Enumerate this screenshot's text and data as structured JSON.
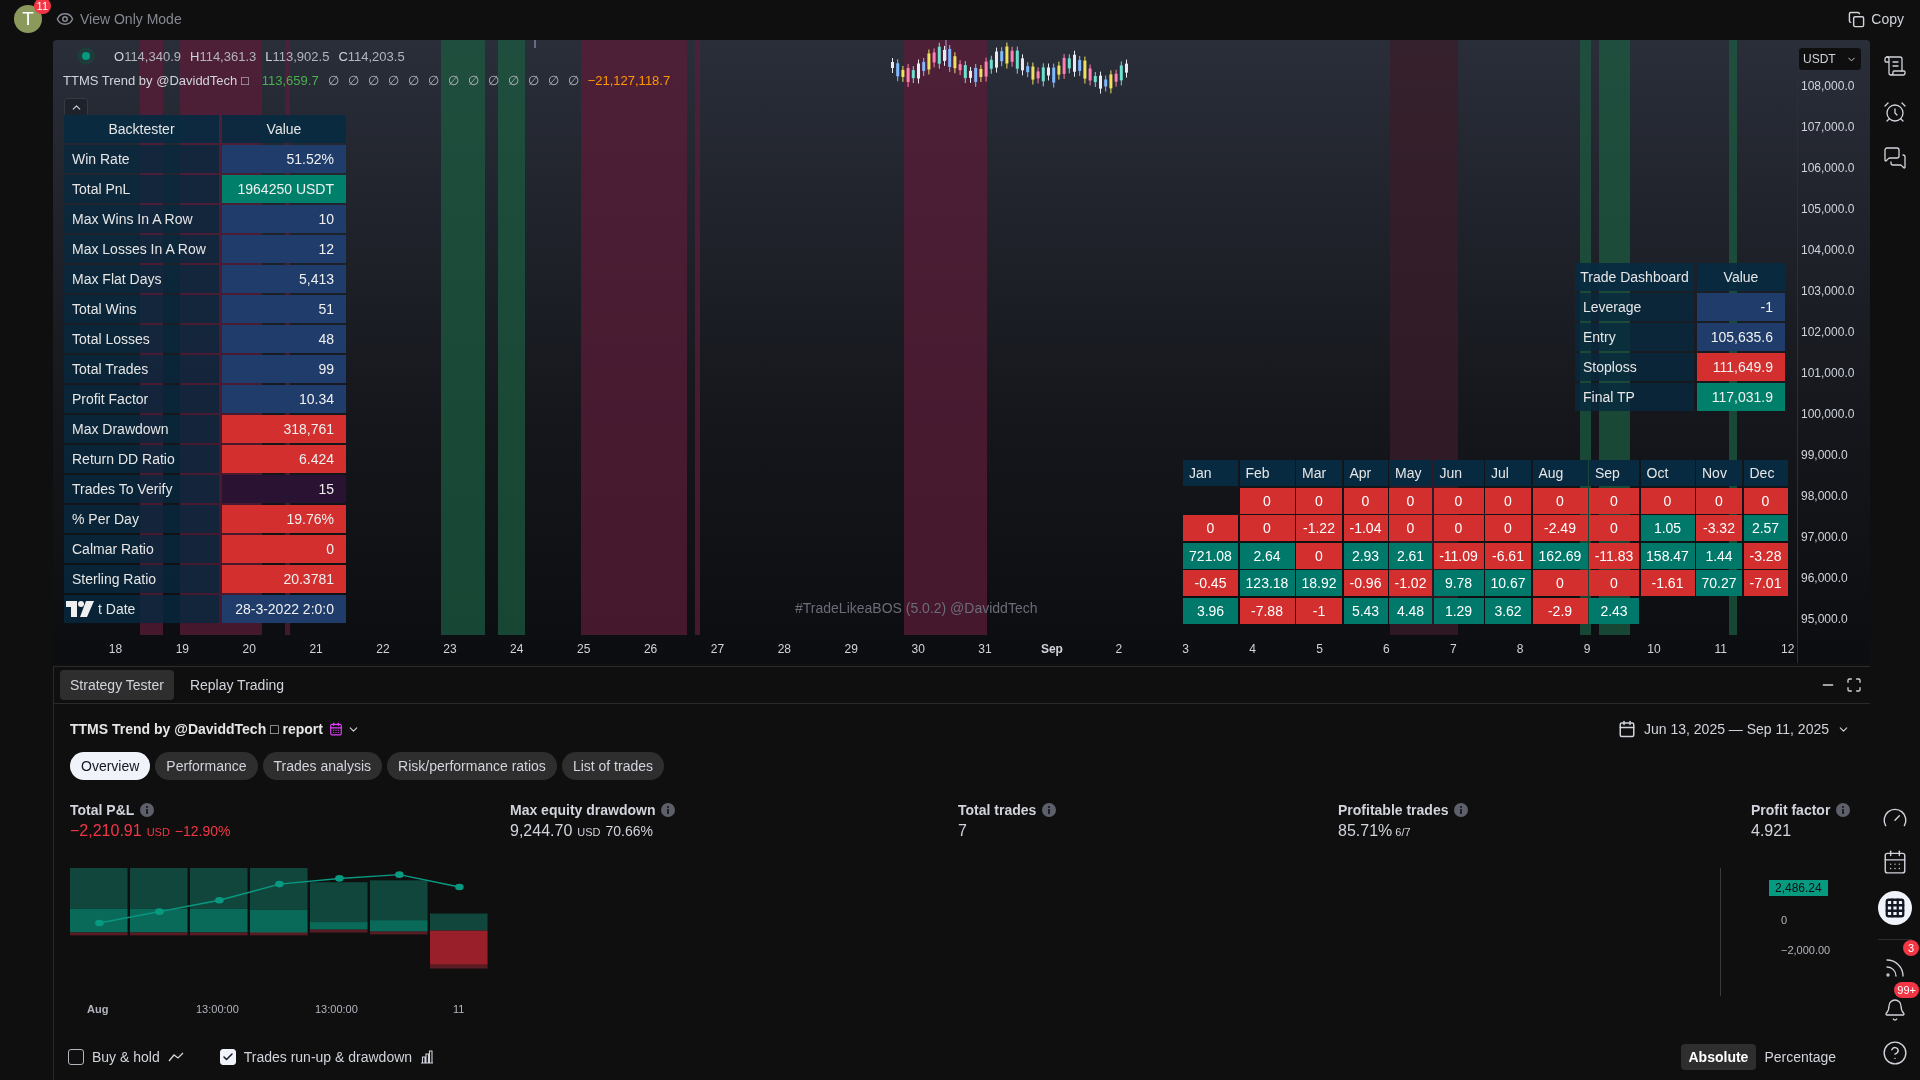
{
  "top_bar": {
    "avatar_initial": "T",
    "avatar_badge": "11",
    "mode": "View Only Mode",
    "copy": "Copy"
  },
  "chart": {
    "ohlc": [
      {
        "key": "O",
        "value": "114,340.9"
      },
      {
        "key": "H",
        "value": "114,361.3"
      },
      {
        "key": "L",
        "value": "113,902.5"
      },
      {
        "key": "C",
        "value": "114,203.5"
      }
    ],
    "indicator": {
      "name": "TTMS Trend by @DaviddTech □",
      "values": [
        {
          "text": "113,659.7",
          "color": "#4caf50"
        },
        {
          "text": "∅"
        },
        {
          "text": "∅"
        },
        {
          "text": "∅"
        },
        {
          "text": "∅"
        },
        {
          "text": "∅"
        },
        {
          "text": "∅"
        },
        {
          "text": "∅"
        },
        {
          "text": "∅"
        },
        {
          "text": "∅"
        },
        {
          "text": "∅"
        },
        {
          "text": "∅"
        },
        {
          "text": "∅"
        },
        {
          "text": "∅"
        },
        {
          "text": "−21,127,118.7",
          "color": "#ff9800"
        }
      ]
    },
    "backtester": {
      "columns": [
        "Backtester",
        "Value"
      ],
      "rows": [
        {
          "label": "Win Rate",
          "value": "51.52%",
          "color": "#1f3c6b",
          "logo_overlay": false
        },
        {
          "label": "Total PnL",
          "value": "1964250 USDT",
          "color": "#00806b",
          "logo_overlay": false
        },
        {
          "label": "Max Wins In A Row",
          "value": "10",
          "color": "#1f3c6b",
          "logo_overlay": false
        },
        {
          "label": "Max Losses In A Row",
          "value": "12",
          "color": "#1f3c6b",
          "logo_overlay": false
        },
        {
          "label": "Max Flat Days",
          "value": "5,413",
          "color": "#1f3c6b",
          "logo_overlay": false
        },
        {
          "label": "Total Wins",
          "value": "51",
          "color": "#1f3c6b",
          "logo_overlay": false
        },
        {
          "label": "Total Losses",
          "value": "48",
          "color": "#1f3c6b",
          "logo_overlay": false
        },
        {
          "label": "Total Trades",
          "value": "99",
          "color": "#1f3c6b",
          "logo_overlay": false
        },
        {
          "label": "Profit Factor",
          "value": "10.34",
          "color": "#1f3c6b",
          "logo_overlay": false
        },
        {
          "label": "Max Drawdown",
          "value": "318,761",
          "color": "#d32f2f",
          "logo_overlay": false
        },
        {
          "label": "Return DD Ratio",
          "value": "6.424",
          "color": "#d32f2f",
          "logo_overlay": false
        },
        {
          "label": "Trades To Verify",
          "value": "15",
          "color": "#2a1232",
          "logo_overlay": false
        },
        {
          "label": "% Per Day",
          "value": "19.76%",
          "color": "#d32f2f",
          "logo_overlay": false
        },
        {
          "label": "Calmar Ratio",
          "value": "0",
          "color": "#d32f2f",
          "logo_overlay": false
        },
        {
          "label": "Sterling Ratio",
          "value": "20.3781",
          "color": "#d32f2f",
          "logo_overlay": false
        },
        {
          "label": "t Date",
          "value": "28-3-2022 2:0:0",
          "color": "#1f3c6b",
          "logo_overlay": true
        }
      ]
    },
    "trade_dashboard": {
      "columns": [
        "Trade Dashboard",
        "Value"
      ],
      "rows": [
        {
          "label": "Leverage",
          "value": "-1",
          "color": "#1f3c6b"
        },
        {
          "label": "Entry",
          "value": "105,635.6",
          "color": "#1f3c6b"
        },
        {
          "label": "Stoploss",
          "value": "111,649.9",
          "color": "#d32f2f"
        },
        {
          "label": "Final TP",
          "value": "117,031.9",
          "color": "#00806b"
        }
      ]
    },
    "monthly": {
      "months": [
        "Jan",
        "Feb",
        "Mar",
        "Apr",
        "May",
        "Jun",
        "Jul",
        "Aug",
        "Sep",
        "Oct",
        "Nov",
        "Dec"
      ],
      "rows": [
        [
          null,
          {
            "text": "0",
            "positive": false
          },
          {
            "text": "0",
            "positive": false
          },
          {
            "text": "0",
            "positive": false
          },
          {
            "text": "0",
            "positive": false
          },
          {
            "text": "0",
            "positive": false
          },
          {
            "text": "0",
            "positive": false
          },
          {
            "text": "0",
            "positive": false
          },
          {
            "text": "0",
            "positive": false
          },
          {
            "text": "0",
            "positive": false
          },
          {
            "text": "0",
            "positive": false
          },
          {
            "text": "0",
            "positive": false
          }
        ],
        [
          {
            "text": "0",
            "positive": false
          },
          {
            "text": "0",
            "positive": false
          },
          {
            "text": "-1.22",
            "positive": false
          },
          {
            "text": "-1.04",
            "positive": false
          },
          {
            "text": "0",
            "positive": false
          },
          {
            "text": "0",
            "positive": false
          },
          {
            "text": "0",
            "positive": false
          },
          {
            "text": "-2.49",
            "positive": false
          },
          {
            "text": "0",
            "positive": false
          },
          {
            "text": "1.05",
            "positive": true
          },
          {
            "text": "-3.32",
            "positive": false
          },
          {
            "text": "2.57",
            "positive": true
          }
        ],
        [
          {
            "text": "721.08",
            "positive": true
          },
          {
            "text": "2.64",
            "positive": true
          },
          {
            "text": "0",
            "positive": false
          },
          {
            "text": "2.93",
            "positive": true
          },
          {
            "text": "2.61",
            "positive": true
          },
          {
            "text": "-11.09",
            "positive": false
          },
          {
            "text": "-6.61",
            "positive": false
          },
          {
            "text": "162.69",
            "positive": true
          },
          {
            "text": "-11.83",
            "positive": false
          },
          {
            "text": "158.47",
            "positive": true
          },
          {
            "text": "1.44",
            "positive": true
          },
          {
            "text": "-3.28",
            "positive": false
          }
        ],
        [
          {
            "text": "-0.45",
            "positive": false
          },
          {
            "text": "123.18",
            "positive": true
          },
          {
            "text": "18.92",
            "positive": true
          },
          {
            "text": "-0.96",
            "positive": false
          },
          {
            "text": "-1.02",
            "positive": false
          },
          {
            "text": "9.78",
            "positive": true
          },
          {
            "text": "10.67",
            "positive": true
          },
          {
            "text": "0",
            "positive": false
          },
          {
            "text": "0",
            "positive": false
          },
          {
            "text": "-1.61",
            "positive": false
          },
          {
            "text": "70.27",
            "positive": true
          },
          {
            "text": "-7.01",
            "positive": false
          }
        ],
        [
          {
            "text": "3.96",
            "positive": true
          },
          {
            "text": "-7.88",
            "positive": false
          },
          {
            "text": "-1",
            "positive": false
          },
          {
            "text": "5.43",
            "positive": true
          },
          {
            "text": "4.48",
            "positive": true
          },
          {
            "text": "1.29",
            "positive": true
          },
          {
            "text": "3.62",
            "positive": true
          },
          {
            "text": "-2.9",
            "positive": false
          },
          {
            "text": "2.43",
            "positive": true
          },
          null,
          null,
          null
        ]
      ]
    },
    "watermark_text": "#TradeLikeaBOS (5.0.2) @DaviddTech",
    "currency": "USDT",
    "price_axis": [
      "108,000.0",
      "107,000.0",
      "106,000.0",
      "105,000.0",
      "104,000.0",
      "103,000.0",
      "102,000.0",
      "101,000.0",
      "100,000.0",
      "99,000.0",
      "98,000.0",
      "97,000.0",
      "96,000.0",
      "95,000.0"
    ],
    "time_axis": [
      {
        "text": "18",
        "kind": "day"
      },
      {
        "text": "19",
        "kind": "day"
      },
      {
        "text": "20",
        "kind": "day"
      },
      {
        "text": "21",
        "kind": "day"
      },
      {
        "text": "22",
        "kind": "day"
      },
      {
        "text": "23",
        "kind": "day"
      },
      {
        "text": "24",
        "kind": "day"
      },
      {
        "text": "25",
        "kind": "day"
      },
      {
        "text": "26",
        "kind": "day"
      },
      {
        "text": "27",
        "kind": "day"
      },
      {
        "text": "28",
        "kind": "day"
      },
      {
        "text": "29",
        "kind": "day"
      },
      {
        "text": "30",
        "kind": "day"
      },
      {
        "text": "31",
        "kind": "day"
      },
      {
        "text": "Sep",
        "kind": "month"
      },
      {
        "text": "2",
        "kind": "day"
      },
      {
        "text": "3",
        "kind": "day"
      },
      {
        "text": "4",
        "kind": "day"
      },
      {
        "text": "5",
        "kind": "day"
      },
      {
        "text": "6",
        "kind": "day"
      },
      {
        "text": "7",
        "kind": "day"
      },
      {
        "text": "8",
        "kind": "day"
      },
      {
        "text": "9",
        "kind": "day"
      },
      {
        "text": "10",
        "kind": "day"
      },
      {
        "text": "11",
        "kind": "day"
      },
      {
        "text": "12",
        "kind": "day"
      }
    ]
  },
  "bottom_panel": {
    "tabs": [
      {
        "label": "Strategy Tester",
        "selected": true
      },
      {
        "label": "Replay Trading",
        "selected": false
      }
    ],
    "report_title": "TTMS Trend by @DaviddTech □ report",
    "date_range": "Jun 13, 2025 — Sep 11, 2025",
    "sections": [
      {
        "label": "Overview",
        "selected": true
      },
      {
        "label": "Performance",
        "selected": false
      },
      {
        "label": "Trades analysis",
        "selected": false
      },
      {
        "label": "Risk/performance ratios",
        "selected": false
      },
      {
        "label": "List of trades",
        "selected": false
      }
    ],
    "metrics": [
      {
        "label": "Total P&L",
        "value": "−2,210.91",
        "unit": "USD",
        "change": "−12.90%",
        "negative": true
      },
      {
        "label": "Max equity drawdown",
        "value": "9,244.70",
        "unit": "USD",
        "change": "70.66%",
        "negative": false
      },
      {
        "label": "Total trades",
        "value": "7",
        "negative": false
      },
      {
        "label": "Profitable trades",
        "value": "85.71%",
        "sub": "6/7",
        "negative": false
      },
      {
        "label": "Profit factor",
        "value": "4.921",
        "negative": false
      }
    ],
    "chart_x_labels": [
      {
        "text": "Aug",
        "kind": "month"
      },
      {
        "text": "13:00:00",
        "kind": "time"
      },
      {
        "text": "13:00:00",
        "kind": "time"
      },
      {
        "text": "11",
        "kind": "day"
      }
    ],
    "chart_y": {
      "badge": "2,486.24",
      "labels": [
        "0",
        "−2,000.00"
      ]
    },
    "options": [
      {
        "label": "Buy & hold",
        "checked": false,
        "kind": "line"
      },
      {
        "label": "Trades run-up & drawdown",
        "checked": true,
        "kind": "bars"
      }
    ],
    "scale": [
      {
        "label": "Absolute",
        "selected": true
      },
      {
        "label": "Percentage",
        "selected": false
      }
    ]
  },
  "sidebar": {
    "feed_badge": "3",
    "alerts_badge": "99+"
  }
}
